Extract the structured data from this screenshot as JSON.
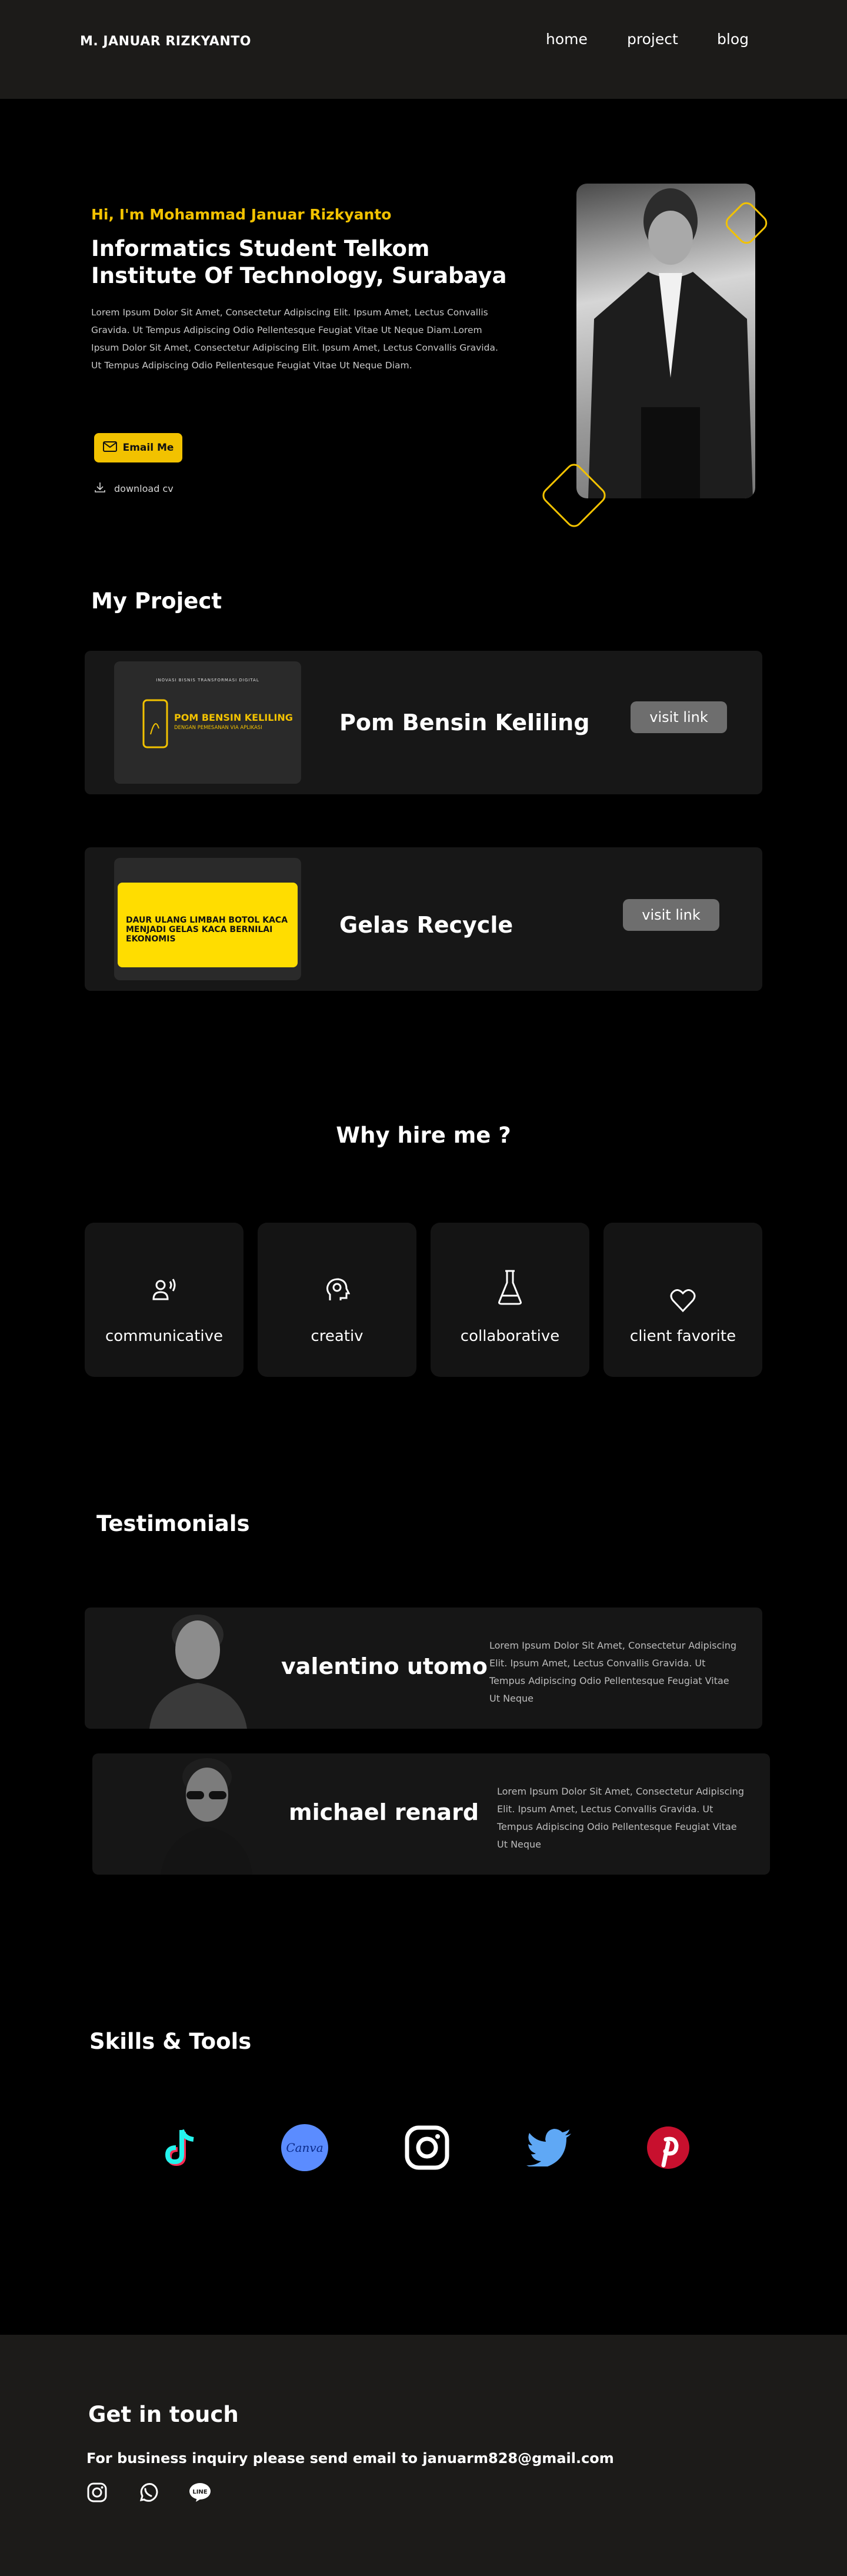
{
  "header": {
    "brand": "M. JANUAR RIZKYANTO",
    "nav": [
      "home",
      "project",
      "blog"
    ]
  },
  "hero": {
    "greeting": "Hi, I'm Mohammad Januar Rizkyanto",
    "title": "Informatics Student Telkom Institute Of Technology, Surabaya",
    "lorem": "Lorem Ipsum Dolor Sit Amet, Consectetur Adipiscing Elit. Ipsum Amet, Lectus Convallis Gravida. Ut Tempus Adipiscing Odio Pellentesque Feugiat Vitae Ut Neque Diam.Lorem Ipsum Dolor Sit Amet, Consectetur Adipiscing Elit. Ipsum Amet, Lectus Convallis Gravida. Ut Tempus Adipiscing Odio Pellentesque Feugiat Vitae Ut Neque Diam.",
    "email_label": "Email  Me",
    "download_label": "download cv"
  },
  "projects": {
    "title": "My Project",
    "items": [
      {
        "name": "Pom Bensin Keliling",
        "link_label": "visit link",
        "thumb_top": "INOVASI BISNIS TRANSFORMASI DIGITAL",
        "thumb_main": "POM BENSIN KELILING",
        "thumb_sub": "DENGAN PEMESANAN VIA APLIKASI"
      },
      {
        "name": "Gelas Recycle",
        "link_label": "visit link",
        "thumb_main": "DAUR ULANG LIMBAH BOTOL KACA MENJADI GELAS KACA BERNILAI EKONOMIS"
      }
    ]
  },
  "why": {
    "title": "Why hire me ?",
    "items": [
      {
        "label": "communicative",
        "icon": "speaking-person-icon"
      },
      {
        "label": "creativ",
        "icon": "head-gear-icon"
      },
      {
        "label": "collaborative",
        "icon": "flask-icon"
      },
      {
        "label": "client favorite",
        "icon": "heart-icon"
      }
    ]
  },
  "testimonials": {
    "title": "Testimonials",
    "items": [
      {
        "name": "valentino utomo",
        "quote": "Lorem Ipsum Dolor Sit Amet, Consectetur Adipiscing Elit. Ipsum Amet, Lectus Convallis Gravida. Ut Tempus Adipiscing Odio Pellentesque Feugiat Vitae Ut Neque"
      },
      {
        "name": "michael renard",
        "quote": "Lorem Ipsum Dolor Sit Amet, Consectetur Adipiscing Elit. Ipsum Amet, Lectus Convallis Gravida. Ut Tempus Adipiscing Odio Pellentesque Feugiat Vitae Ut Neque"
      }
    ]
  },
  "skills": {
    "title": "Skills & Tools",
    "items": [
      {
        "name": "tiktok-icon",
        "color": "#25f4ee"
      },
      {
        "name": "canva-icon",
        "color": "#5b8cff",
        "text": "Canva"
      },
      {
        "name": "instagram-icon",
        "color": "#ffffff"
      },
      {
        "name": "twitter-icon",
        "color": "#5fa8f5"
      },
      {
        "name": "pinterest-icon",
        "color": "#c8102e"
      }
    ]
  },
  "footer": {
    "title": "Get in touch",
    "text": "For business inquiry please send email to januarm828@gmail.com",
    "icons": [
      "instagram-icon",
      "whatsapp-icon",
      "line-icon"
    ],
    "line_text": "LINE"
  },
  "colors": {
    "accent": "#f2c200",
    "panel": "#171717",
    "header": "#1c1b19"
  }
}
